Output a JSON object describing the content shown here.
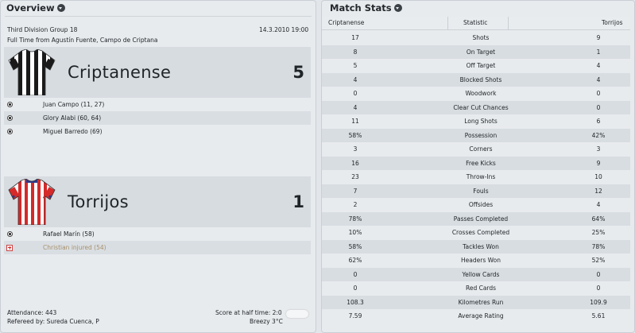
{
  "overview": {
    "title": "Overview",
    "competition": "Third Division Group 18",
    "datetime": "14.3.2010 19:00",
    "venue": "Full Time from Agustín Fuente, Campo de Criptana",
    "home": {
      "name": "Criptanense",
      "score": "5",
      "shirt_colors": [
        "#1a1a1a",
        "#ffffff"
      ],
      "events": [
        {
          "type": "goal",
          "text": "Juan Campo (11, 27)"
        },
        {
          "type": "goal",
          "text": "Glory Alabi (60, 64)"
        },
        {
          "type": "goal",
          "text": "Miguel Barredo (69)"
        }
      ]
    },
    "away": {
      "name": "Torrijos",
      "score": "1",
      "shirt_colors": [
        "#d42a2a",
        "#ffffff"
      ],
      "events": [
        {
          "type": "goal",
          "text": "Rafael Marín (58)"
        },
        {
          "type": "injury",
          "text": "Christian injured (54)"
        }
      ]
    },
    "attendance": "Attendance: 443",
    "referee": "Refereed by: Sureda Cuenca, P",
    "halftime": "Score at half time: 2:0",
    "weather": "Breezy 3°C",
    "weather_icon": "cloud-icon"
  },
  "stats": {
    "title": "Match Stats",
    "headers": {
      "home": "Criptanense",
      "stat": "Statistic",
      "away": "Torrijos"
    },
    "rows": [
      {
        "home": "17",
        "stat": "Shots",
        "away": "9"
      },
      {
        "home": "8",
        "stat": "On Target",
        "away": "1"
      },
      {
        "home": "5",
        "stat": "Off Target",
        "away": "4"
      },
      {
        "home": "4",
        "stat": "Blocked Shots",
        "away": "4"
      },
      {
        "home": "0",
        "stat": "Woodwork",
        "away": "0"
      },
      {
        "home": "4",
        "stat": "Clear Cut Chances",
        "away": "0"
      },
      {
        "home": "11",
        "stat": "Long Shots",
        "away": "6"
      },
      {
        "home": "58%",
        "stat": "Possession",
        "away": "42%"
      },
      {
        "home": "3",
        "stat": "Corners",
        "away": "3"
      },
      {
        "home": "16",
        "stat": "Free Kicks",
        "away": "9"
      },
      {
        "home": "23",
        "stat": "Throw-Ins",
        "away": "10"
      },
      {
        "home": "7",
        "stat": "Fouls",
        "away": "12"
      },
      {
        "home": "2",
        "stat": "Offsides",
        "away": "4"
      },
      {
        "home": "78%",
        "stat": "Passes Completed",
        "away": "64%"
      },
      {
        "home": "10%",
        "stat": "Crosses Completed",
        "away": "25%"
      },
      {
        "home": "58%",
        "stat": "Tackles Won",
        "away": "78%"
      },
      {
        "home": "62%",
        "stat": "Headers Won",
        "away": "52%"
      },
      {
        "home": "0",
        "stat": "Yellow Cards",
        "away": "0"
      },
      {
        "home": "0",
        "stat": "Red Cards",
        "away": "0"
      },
      {
        "home": "108.3",
        "stat": "Kilometres Run",
        "away": "109.9"
      },
      {
        "home": "7.59",
        "stat": "Average Rating",
        "away": "5.61"
      }
    ]
  }
}
